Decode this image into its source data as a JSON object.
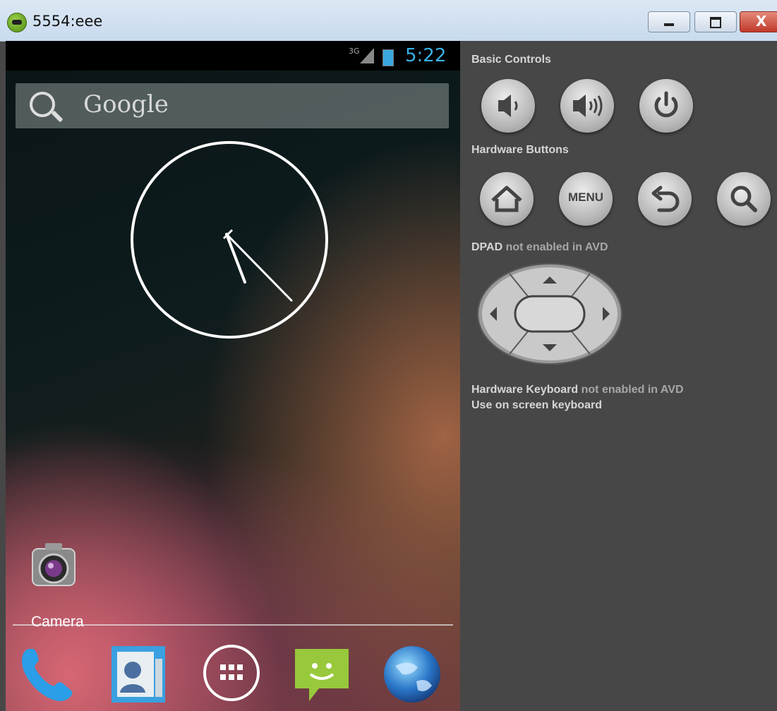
{
  "window": {
    "title": "5554:eee",
    "controls": [
      "minimize",
      "maximize",
      "close"
    ],
    "close_glyph": "X"
  },
  "phone": {
    "status_bar": {
      "network": "3G",
      "time": "5:22"
    },
    "search": {
      "label": "Google"
    },
    "home_icon": {
      "label": "Camera"
    },
    "dock": [
      "phone-icon",
      "contacts-icon",
      "app-drawer-icon",
      "messaging-icon",
      "browser-icon"
    ]
  },
  "controls_panel": {
    "basic_controls": {
      "heading": "Basic Controls",
      "buttons": [
        "volume-down-icon",
        "volume-up-icon",
        "power-icon"
      ]
    },
    "hardware_buttons": {
      "heading": "Hardware Buttons",
      "menu_label": "MENU",
      "buttons": [
        "home-icon",
        "menu",
        "back-icon",
        "search-icon"
      ]
    },
    "dpad": {
      "name": "DPAD",
      "status": " not enabled in AVD"
    },
    "keyboard": {
      "name": "Hardware Keyboard",
      "status": " not enabled in AVD",
      "hint": "Use on screen keyboard"
    }
  }
}
